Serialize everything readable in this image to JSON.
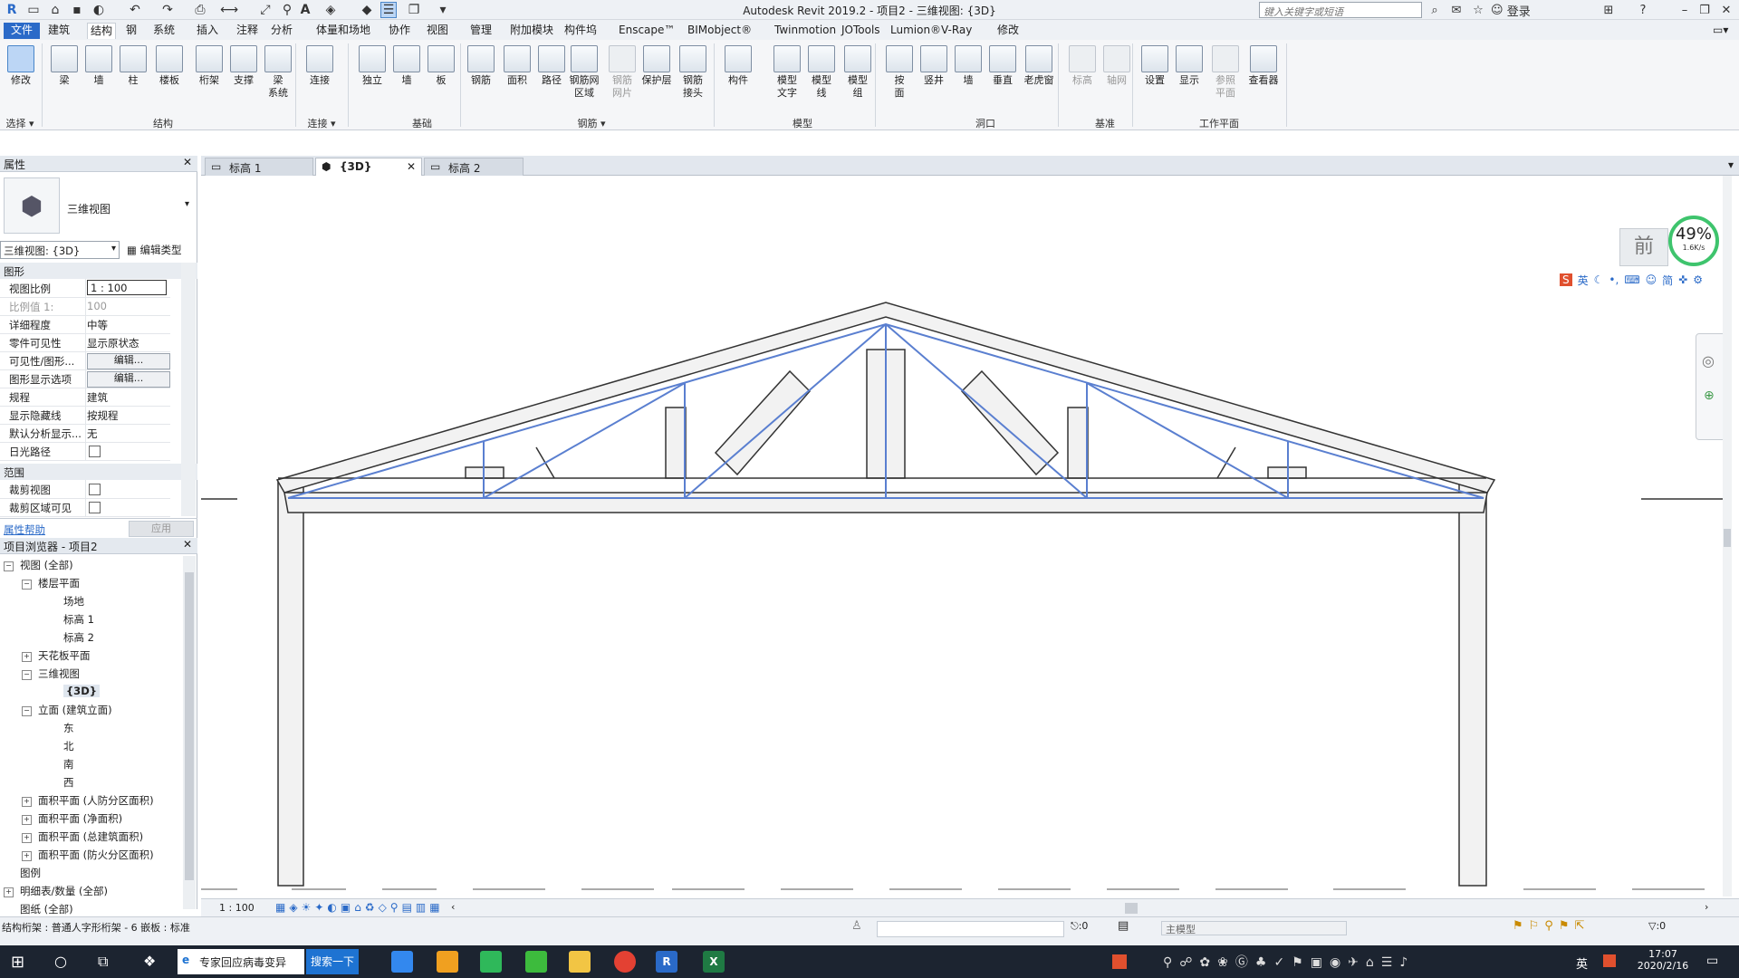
{
  "app": {
    "title": "Autodesk Revit 2019.2 - 项目2 - 三维视图: {3D}",
    "search_placeholder": "键入关键字或短语",
    "login_label": "登录"
  },
  "menu_tabs": [
    "文件",
    "建筑",
    "结构",
    "钢",
    "系统",
    "插入",
    "注释",
    "分析",
    "体量和场地",
    "协作",
    "视图",
    "管理",
    "附加模块",
    "构件坞",
    "Enscape™",
    "BIMobject®",
    "Twinmotion",
    "JOTools",
    "Lumion®",
    "V-Ray",
    "修改"
  ],
  "active_menu_index": 2,
  "ribbon": {
    "buttons": [
      {
        "label": "修改",
        "dim": false,
        "selected": true
      },
      {
        "label": "梁",
        "dim": false
      },
      {
        "label": "墙",
        "dim": false
      },
      {
        "label": "柱",
        "dim": false
      },
      {
        "label": "楼板",
        "dim": false
      },
      {
        "label": "桁架",
        "dim": false
      },
      {
        "label": "支撑",
        "dim": false
      },
      {
        "label": "梁\n系统",
        "dim": false
      },
      {
        "label": "连接",
        "dim": false
      },
      {
        "label": "独立",
        "dim": false
      },
      {
        "label": "墙",
        "dim": false
      },
      {
        "label": "板",
        "dim": false
      },
      {
        "label": "钢筋",
        "dim": false
      },
      {
        "label": "面积",
        "dim": false
      },
      {
        "label": "路径",
        "dim": false
      },
      {
        "label": "钢筋网\n区域",
        "dim": false
      },
      {
        "label": "钢筋\n网片",
        "dim": true
      },
      {
        "label": "保护层",
        "dim": false
      },
      {
        "label": "钢筋\n接头",
        "dim": false
      },
      {
        "label": "构件",
        "dim": false
      },
      {
        "label": "模型\n文字",
        "dim": false
      },
      {
        "label": "模型\n线",
        "dim": false
      },
      {
        "label": "模型\n组",
        "dim": false
      },
      {
        "label": "按\n面",
        "dim": false
      },
      {
        "label": "竖井",
        "dim": false
      },
      {
        "label": "墙",
        "dim": false
      },
      {
        "label": "垂直",
        "dim": false
      },
      {
        "label": "老虎窗",
        "dim": false
      },
      {
        "label": "标高",
        "dim": true
      },
      {
        "label": "轴网",
        "dim": true
      },
      {
        "label": "设置",
        "dim": false
      },
      {
        "label": "显示",
        "dim": false
      },
      {
        "label": "参照\n平面",
        "dim": true
      },
      {
        "label": "查看器",
        "dim": false
      }
    ],
    "panels": [
      "选择 ▾",
      "结构",
      "连接 ▾",
      "基础",
      "钢筋 ▾",
      "模型",
      "洞口",
      "基准",
      "工作平面"
    ]
  },
  "properties": {
    "header": "属性",
    "type_name": "三维视图",
    "instance_selector": "三维视图: {3D}",
    "edit_type": "编辑类型",
    "group_graphics": "图形",
    "rows": [
      {
        "k": "视图比例",
        "v": "1 : 100",
        "kind": "input"
      },
      {
        "k": "比例值 1:",
        "v": "100",
        "kind": "dim"
      },
      {
        "k": "详细程度",
        "v": "中等",
        "kind": "text"
      },
      {
        "k": "零件可见性",
        "v": "显示原状态",
        "kind": "text"
      },
      {
        "k": "可见性/图形...",
        "v": "编辑...",
        "kind": "button"
      },
      {
        "k": "图形显示选项",
        "v": "编辑...",
        "kind": "button"
      },
      {
        "k": "规程",
        "v": "建筑",
        "kind": "text"
      },
      {
        "k": "显示隐藏线",
        "v": "按规程",
        "kind": "text"
      },
      {
        "k": "默认分析显示...",
        "v": "无",
        "kind": "text"
      },
      {
        "k": "日光路径",
        "v": "",
        "kind": "check"
      }
    ],
    "group_extents": "范围",
    "rows2": [
      {
        "k": "裁剪视图",
        "v": "",
        "kind": "check"
      },
      {
        "k": "裁剪区域可见",
        "v": "",
        "kind": "check"
      }
    ],
    "help_link": "属性帮助",
    "apply": "应用"
  },
  "browser": {
    "header": "项目浏览器 - 项目2",
    "items": [
      {
        "label": "视图 (全部)",
        "level": 0,
        "toggle": "-"
      },
      {
        "label": "楼层平面",
        "level": 1,
        "toggle": "-"
      },
      {
        "label": "场地",
        "level": 2,
        "toggle": ""
      },
      {
        "label": "标高 1",
        "level": 2,
        "toggle": ""
      },
      {
        "label": "标高 2",
        "level": 2,
        "toggle": ""
      },
      {
        "label": "天花板平面",
        "level": 1,
        "toggle": "+"
      },
      {
        "label": "三维视图",
        "level": 1,
        "toggle": "-"
      },
      {
        "label": "{3D}",
        "level": 2,
        "toggle": "",
        "bold": true
      },
      {
        "label": "立面 (建筑立面)",
        "level": 1,
        "toggle": "-"
      },
      {
        "label": "东",
        "level": 2,
        "toggle": ""
      },
      {
        "label": "北",
        "level": 2,
        "toggle": ""
      },
      {
        "label": "南",
        "level": 2,
        "toggle": ""
      },
      {
        "label": "西",
        "level": 2,
        "toggle": ""
      },
      {
        "label": "面积平面 (人防分区面积)",
        "level": 1,
        "toggle": "+"
      },
      {
        "label": "面积平面 (净面积)",
        "level": 1,
        "toggle": "+"
      },
      {
        "label": "面积平面 (总建筑面积)",
        "level": 1,
        "toggle": "+"
      },
      {
        "label": "面积平面 (防火分区面积)",
        "level": 1,
        "toggle": "+"
      },
      {
        "label": "图例",
        "level": 0,
        "toggle": ""
      },
      {
        "label": "明细表/数量 (全部)",
        "level": 0,
        "toggle": "+"
      },
      {
        "label": "图纸 (全部)",
        "level": 0,
        "toggle": ""
      }
    ]
  },
  "view_tabs": [
    {
      "label": "标高 1",
      "active": false
    },
    {
      "label": "{3D}",
      "active": true
    },
    {
      "label": "标高 2",
      "active": false
    }
  ],
  "viewcube_face": "前",
  "perf_widget": {
    "percent": "49%",
    "rate": "1.6K/s"
  },
  "ime_bar": [
    "英",
    "简"
  ],
  "view_scale": "1 : 100",
  "statusbar": {
    "message": "结构桁架 : 普通人字形桁架 - 6 嵌板 : 标准",
    "zero": ":0",
    "model_label": "主模型",
    "filter_count": ":0"
  },
  "taskbar": {
    "news": "专家回应病毒变异",
    "search_btn": "搜索一下",
    "lang": "英",
    "time": "17:07",
    "date": "2020/2/16"
  },
  "colors": {
    "accent": "#2a6ac8",
    "truss_blue": "#5a7fd0",
    "taskbar": "#1c2430"
  }
}
